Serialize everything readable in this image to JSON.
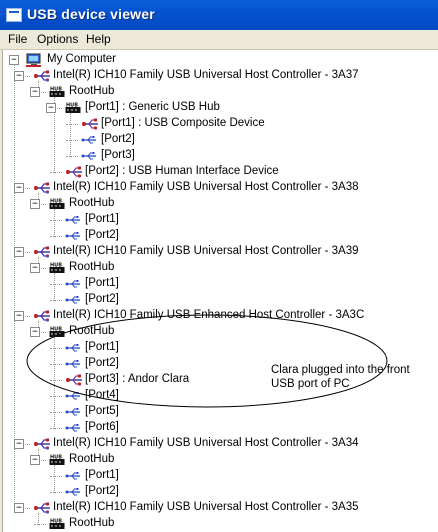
{
  "window": {
    "title": "USB device viewer"
  },
  "menu": [
    {
      "label": "File"
    },
    {
      "label": "Options"
    },
    {
      "label": "Help"
    }
  ],
  "tree": {
    "root": "My Computer",
    "rows": [
      {
        "text": "Intel(R) ICH10 Family USB Universal Host Controller - 3A37",
        "kind": "controller",
        "level": 1
      },
      {
        "text": "RootHub",
        "kind": "hub",
        "level": 2
      },
      {
        "text": "[Port1]  :  Generic USB Hub",
        "kind": "hub",
        "level": 3
      },
      {
        "text": "[Port1]  :  USB Composite Device",
        "kind": "device",
        "level": 4
      },
      {
        "text": "[Port2]",
        "kind": "port",
        "level": 4
      },
      {
        "text": "[Port3]",
        "kind": "port",
        "level": 4
      },
      {
        "text": "[Port2]  :  USB Human Interface Device",
        "kind": "device",
        "level": 3
      },
      {
        "text": "Intel(R) ICH10 Family USB Universal Host Controller - 3A38",
        "kind": "controller",
        "level": 1
      },
      {
        "text": "RootHub",
        "kind": "hub",
        "level": 2
      },
      {
        "text": "[Port1]",
        "kind": "port",
        "level": 3
      },
      {
        "text": "[Port2]",
        "kind": "port",
        "level": 3
      },
      {
        "text": "Intel(R) ICH10 Family USB Universal Host Controller - 3A39",
        "kind": "controller",
        "level": 1
      },
      {
        "text": "RootHub",
        "kind": "hub",
        "level": 2
      },
      {
        "text": "[Port1]",
        "kind": "port",
        "level": 3
      },
      {
        "text": "[Port2]",
        "kind": "port",
        "level": 3
      },
      {
        "text": "Intel(R) ICH10 Family USB Enhanced Host Controller - 3A3C",
        "kind": "controller",
        "level": 1
      },
      {
        "text": "RootHub",
        "kind": "hub",
        "level": 2
      },
      {
        "text": "[Port1]",
        "kind": "port",
        "level": 3
      },
      {
        "text": "[Port2]",
        "kind": "port",
        "level": 3
      },
      {
        "text": "[Port3]  :  Andor Clara",
        "kind": "device",
        "level": 3
      },
      {
        "text": "[Port4]",
        "kind": "port",
        "level": 3
      },
      {
        "text": "[Port5]",
        "kind": "port",
        "level": 3
      },
      {
        "text": "[Port6]",
        "kind": "port",
        "level": 3
      },
      {
        "text": "Intel(R) ICH10 Family USB Universal Host Controller - 3A34",
        "kind": "controller",
        "level": 1
      },
      {
        "text": "RootHub",
        "kind": "hub",
        "level": 2
      },
      {
        "text": "[Port1]",
        "kind": "port",
        "level": 3
      },
      {
        "text": "[Port2]",
        "kind": "port",
        "level": 3
      },
      {
        "text": "Intel(R) ICH10 Family USB Universal Host Controller - 3A35",
        "kind": "controller",
        "level": 1
      },
      {
        "text": "RootHub",
        "kind": "hub",
        "level": 2
      }
    ]
  },
  "annotation": {
    "line1": "Clara plugged into the front",
    "line2": "USB port of PC"
  }
}
